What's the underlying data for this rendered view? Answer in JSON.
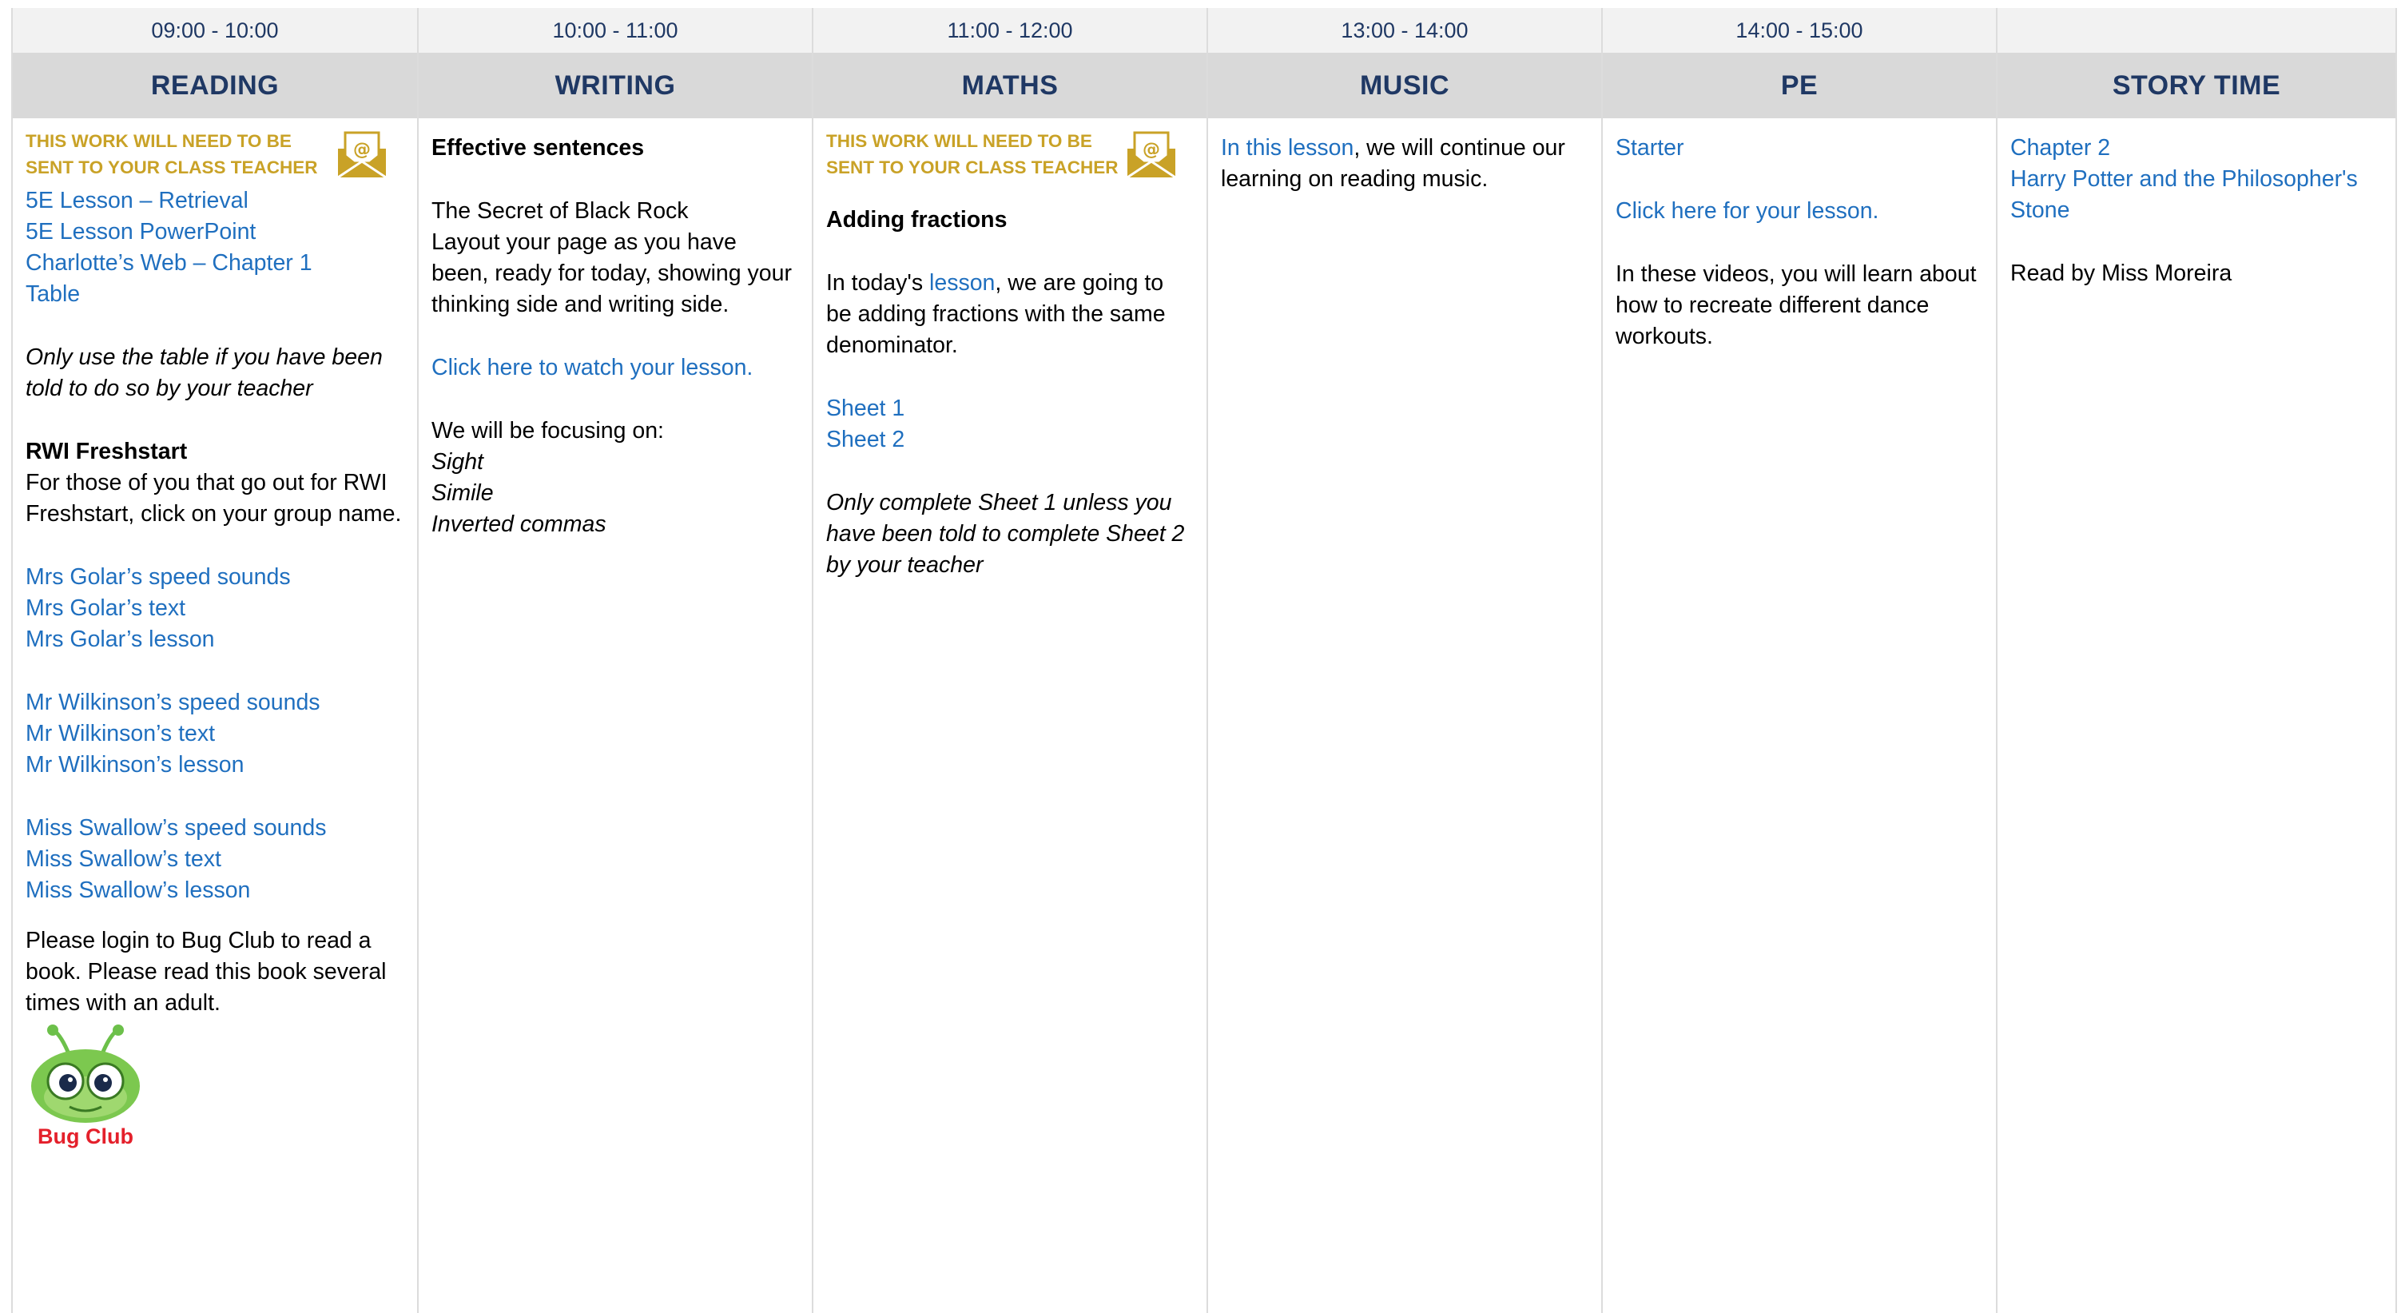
{
  "times": [
    "09:00 - 10:00",
    "10:00 - 11:00",
    "11:00 - 12:00",
    "13:00 - 14:00",
    "14:00 - 15:00",
    ""
  ],
  "subjects": [
    "READING",
    "WRITING",
    "MATHS",
    "MUSIC",
    "PE",
    "STORY TIME"
  ],
  "colors": {
    "header_text": "#1f3864",
    "link": "#1f6fbf",
    "notice": "#c9a227",
    "time_bg": "#f2f2f2",
    "subject_bg": "#d9d9d9"
  },
  "reading": {
    "notice_line1": "THIS WORK WILL NEED TO BE",
    "notice_line2": "SENT TO YOUR CLASS TEACHER",
    "notice_icon": "envelope-icon",
    "links": [
      "5E Lesson – Retrieval",
      "5E Lesson PowerPoint",
      "Charlotte’s Web – Chapter 1",
      "Table"
    ],
    "table_note": "Only use the table if you have been told to do so by your teacher",
    "rwi_heading": "RWI Freshstart",
    "rwi_text": "For those of you that go out for RWI Freshstart, click on your group name.",
    "golar": [
      "Mrs Golar’s speed sounds",
      "Mrs Golar’s text",
      "Mrs Golar’s lesson"
    ],
    "wilkinson": [
      "Mr Wilkinson’s speed sounds",
      "Mr Wilkinson’s text",
      "Mr Wilkinson’s lesson"
    ],
    "swallow": [
      "Miss Swallow’s speed sounds",
      "Miss Swallow’s text",
      "Miss Swallow’s lesson"
    ],
    "bugclub_text": "Please login to Bug Club to read a book. Please read this book several times with an adult.",
    "bugclub_logo": "Bug Club"
  },
  "writing": {
    "heading": "Effective sentences",
    "para": "The Secret of Black Rock Layout your page as you have been, ready for today, showing your thinking side and writing side.",
    "para_title": "The Secret of Black Rock",
    "para_body": "Layout your page as you have been, ready for today, showing your thinking side and writing side.",
    "link": "Click here to watch your lesson.",
    "focus_intro": "We will be focusing on:",
    "focus_items": [
      "Sight",
      "Simile",
      "Inverted commas"
    ]
  },
  "maths": {
    "notice_line1": "THIS WORK WILL NEED TO BE",
    "notice_line2": "SENT TO YOUR CLASS TEACHER",
    "heading": "Adding fractions",
    "intro_pre": "In today's ",
    "intro_link": "lesson",
    "intro_post": ", we are going to be adding fractions with the same denominator.",
    "sheets": [
      "Sheet 1",
      "Sheet 2"
    ],
    "note": "Only complete Sheet 1 unless you have been told to complete Sheet 2 by your teacher"
  },
  "music": {
    "link": "In this lesson",
    "text": ", we will continue our learning on reading music."
  },
  "pe": {
    "starter": "Starter",
    "lesson_link": "Click here for your lesson.",
    "text": "In these videos, you will learn about how to recreate different dance workouts."
  },
  "story": {
    "chapter": "Chapter 2",
    "book": "Harry Potter and the Philosopher's Stone",
    "reader": "Read by Miss Moreira"
  }
}
